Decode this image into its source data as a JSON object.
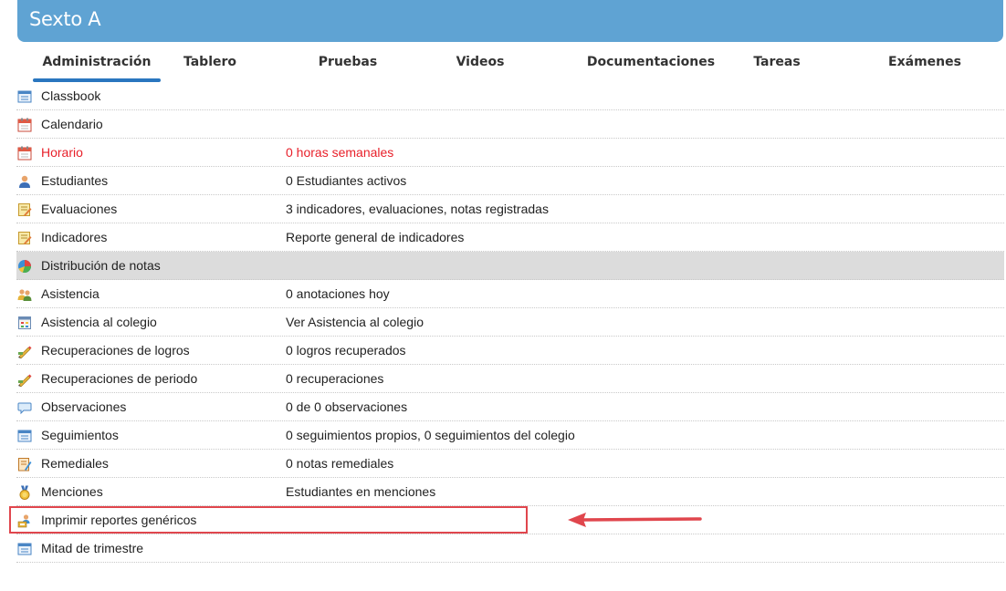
{
  "header": {
    "title": "Sexto A",
    "color": "#5fa3d3"
  },
  "tabs": [
    {
      "label": "Administración",
      "active": true
    },
    {
      "label": "Tablero"
    },
    {
      "label": "Pruebas"
    },
    {
      "label": "Videos"
    },
    {
      "label": "Documentaciones"
    },
    {
      "label": "Tareas"
    },
    {
      "label": "Exámenes"
    }
  ],
  "rows": [
    {
      "name": "Classbook",
      "info": "",
      "icon": "list-window-icon"
    },
    {
      "name": "Calendario",
      "info": "",
      "icon": "calendar-icon"
    },
    {
      "name": "Horario",
      "info": "0 horas semanales",
      "icon": "calendar-icon",
      "color": "#e8202a"
    },
    {
      "name": "Estudiantes",
      "info": "0 Estudiantes activos",
      "icon": "student-icon"
    },
    {
      "name": "Evaluaciones",
      "info": "3 indicadores, evaluaciones, notas registradas",
      "icon": "notepad-pencil-icon"
    },
    {
      "name": "Indicadores",
      "info": "Reporte general de indicadores",
      "icon": "notepad-pencil-icon"
    },
    {
      "name": "Distribución de notas",
      "info": "",
      "icon": "pie-chart-icon",
      "highlighted": true
    },
    {
      "name": "Asistencia",
      "info": "0 anotaciones hoy",
      "icon": "group-users-icon"
    },
    {
      "name": "Asistencia al colegio",
      "info": "Ver Asistencia al colegio",
      "icon": "calendar-grid-icon"
    },
    {
      "name": "Recuperaciones de logros",
      "info": "0 logros recuperados",
      "icon": "pencil-edit-icon"
    },
    {
      "name": "Recuperaciones de periodo",
      "info": "0 recuperaciones",
      "icon": "pencil-edit-icon"
    },
    {
      "name": "Observaciones",
      "info": "0 de 0 observaciones",
      "icon": "speech-bubble-icon"
    },
    {
      "name": "Seguimientos",
      "info": "0 seguimientos propios, 0 seguimientos del colegio",
      "icon": "list-window-icon"
    },
    {
      "name": "Remediales",
      "info": "0 notas remediales",
      "icon": "notepad-edit-icon"
    },
    {
      "name": "Menciones",
      "info": "Estudiantes en menciones",
      "icon": "medal-icon"
    },
    {
      "name": "Imprimir reportes genéricos",
      "info": "",
      "icon": "printer-users-icon"
    },
    {
      "name": "Mitad de trimestre",
      "info": "",
      "icon": "list-window-icon"
    }
  ],
  "annotation": {
    "highlighted_row": "Imprimir reportes genéricos",
    "color": "#e0464d"
  }
}
